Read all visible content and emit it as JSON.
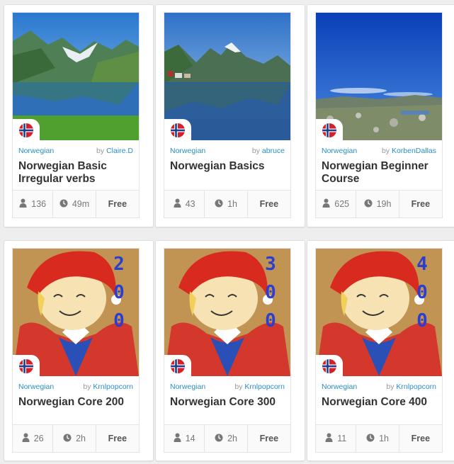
{
  "courses": [
    {
      "language": "Norwegian",
      "by_prefix": "by",
      "author": "Claire.D",
      "title_line1": "Norwegian Basic",
      "title_line2": "Irregular verbs",
      "learners": "136",
      "duration": "49m",
      "price": "Free",
      "thumb": "fjord-green"
    },
    {
      "language": "Norwegian",
      "by_prefix": "by",
      "author": "abruce",
      "title_line1": "Norwegian Basics",
      "title_line2": "",
      "learners": "43",
      "duration": "1h",
      "price": "Free",
      "thumb": "fjord-village"
    },
    {
      "language": "Norwegian",
      "by_prefix": "by",
      "author": "KorbenDallas",
      "title_line1": "Norwegian Beginner",
      "title_line2": "Course",
      "learners": "625",
      "duration": "19h",
      "price": "Free",
      "thumb": "plateau-sky"
    },
    {
      "language": "Norwegian",
      "by_prefix": "by",
      "author": "Krnlpopcorn",
      "title_line1": "Norwegian Core 200",
      "title_line2": "",
      "learners": "26",
      "duration": "2h",
      "price": "Free",
      "thumb": "gnome",
      "digits": [
        "2",
        "0",
        "0"
      ]
    },
    {
      "language": "Norwegian",
      "by_prefix": "by",
      "author": "Krnlpopcorn",
      "title_line1": "Norwegian Core 300",
      "title_line2": "",
      "learners": "14",
      "duration": "2h",
      "price": "Free",
      "thumb": "gnome",
      "digits": [
        "3",
        "0",
        "0"
      ]
    },
    {
      "language": "Norwegian",
      "by_prefix": "by",
      "author": "Krnlpopcorn",
      "title_line1": "Norwegian Core 400",
      "title_line2": "",
      "learners": "11",
      "duration": "1h",
      "price": "Free",
      "thumb": "gnome",
      "digits": [
        "4",
        "0",
        "0"
      ]
    }
  ],
  "icons": {
    "learners": "person-icon",
    "duration": "clock-icon",
    "flag": "norway-flag-icon"
  },
  "colors": {
    "link": "#2a8fc7",
    "flag_red": "#d81e2a",
    "flag_blue": "#1b3f8f",
    "digit_blue": "#2a3fd0"
  }
}
